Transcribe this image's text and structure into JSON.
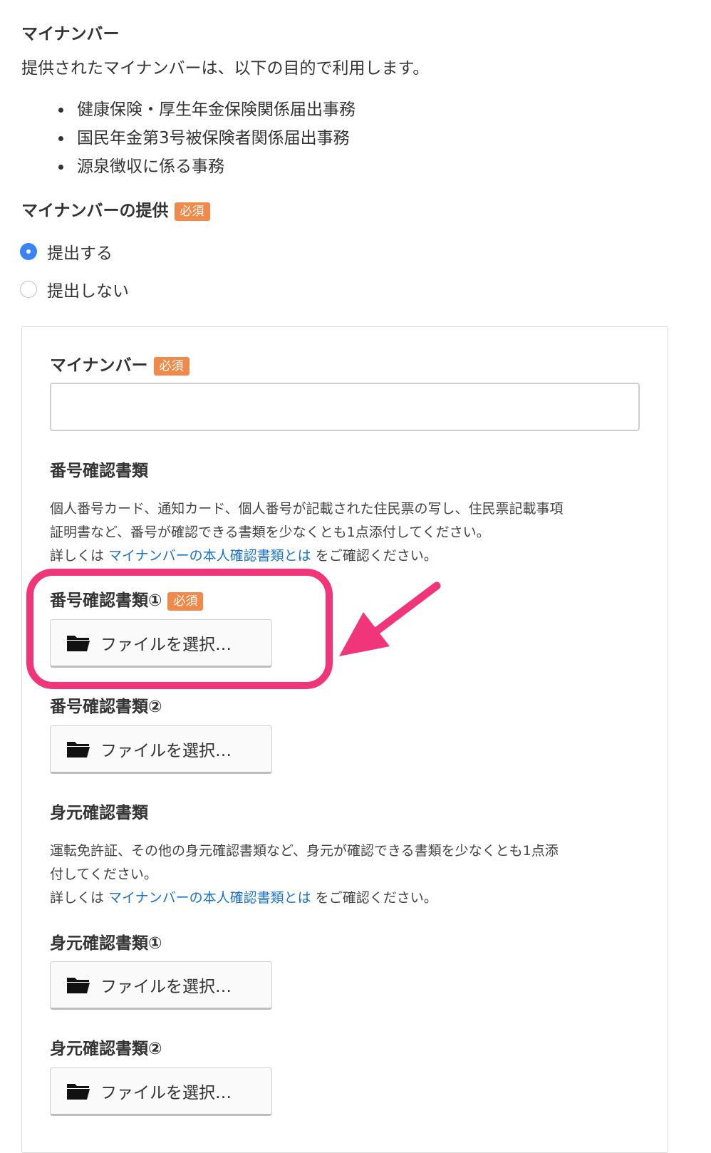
{
  "section": {
    "title": "マイナンバー",
    "intro": "提供されたマイナンバーは、以下の目的で利用します。",
    "purposes": [
      "健康保険・厚生年金保険関係届出事務",
      "国民年金第3号被保険者関係届出事務",
      "源泉徴収に係る事務"
    ]
  },
  "provide": {
    "label": "マイナンバーの提供",
    "required": "必須",
    "options": [
      {
        "label": "提出する",
        "selected": true
      },
      {
        "label": "提出しない",
        "selected": false
      }
    ]
  },
  "form": {
    "number_label": "マイナンバー",
    "number_required": "必須",
    "number_value": "",
    "number_docs": {
      "title": "番号確認書類",
      "desc_line1": "個人番号カード、通知カード、個人番号が記載された住民票の写し、住民票記載事項",
      "desc_line2": "証明書など、番号が確認できる書類を少なくとも1点添付してください。",
      "detail_prefix": "詳しくは ",
      "detail_link": "マイナンバーの本人確認書類とは",
      "detail_suffix": " をご確認ください。",
      "doc1_label": "番号確認書類①",
      "doc1_required": "必須",
      "doc2_label": "番号確認書類②"
    },
    "identity_docs": {
      "title": "身元確認書類",
      "desc_line1": "運転免許証、その他の身元確認書類など、身元が確認できる書類を少なくとも1点添",
      "desc_line2": "付してください。",
      "detail_prefix": "詳しくは ",
      "detail_link": "マイナンバーの本人確認書類とは",
      "detail_suffix": " をご確認ください。",
      "doc1_label": "身元確認書類①",
      "doc2_label": "身元確認書類②"
    },
    "file_button_label": "ファイルを選択…"
  },
  "colors": {
    "required_badge": "#f08a4b",
    "radio_selected": "#3b82f6",
    "link": "#1a73c9",
    "highlight": "#f0357a"
  },
  "icons": [
    "folder-icon",
    "radio-selected",
    "radio-unselected",
    "arrow-annotation"
  ]
}
